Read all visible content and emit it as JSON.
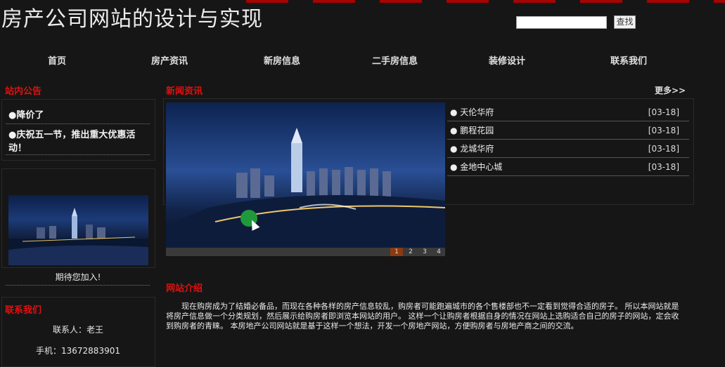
{
  "header": {
    "title": "房产公司网站的设计与实现"
  },
  "search": {
    "placeholder": "",
    "button_label": "查找"
  },
  "nav": {
    "items": [
      "首页",
      "房产资讯",
      "新房信息",
      "二手房信息",
      "装修设计",
      "联系我们"
    ]
  },
  "notice": {
    "title": "站内公告",
    "items": [
      "●降价了",
      "●庆祝五一节，推出重大优惠活动！"
    ]
  },
  "welcome": "期待您加入!",
  "contact": {
    "title": "联系我们",
    "person": "联系人：老王",
    "phone": "手机：13672883901"
  },
  "news": {
    "title": "新闻资讯",
    "more": "更多>>",
    "items": [
      {
        "title": "天伦华府",
        "date": "[03-18]"
      },
      {
        "title": "鹏程花园",
        "date": "[03-18]"
      },
      {
        "title": "龙城华府",
        "date": "[03-18]"
      },
      {
        "title": "金地中心城",
        "date": "[03-18]"
      }
    ]
  },
  "banner": {
    "pages": [
      "1",
      "2",
      "3",
      "4"
    ],
    "active_page": "1",
    "active_color": "#8a3a10"
  },
  "intro": {
    "title": "网站介绍",
    "text": "现在购房成为了结婚必备品，而现在各种各样的房产信息较乱，购房者可能跑遍城市的各个售楼部也不一定看到觉得合适的房子。 所以本网站就是将房产信息做一个分类规划，然后展示给购房者即浏览本网站的用户。 这样一个让购房者根据自身的情况在网站上选购适合自己的房子的网站，定会收到购房者的青睐。 本房地产公司网站就是基于这样一个想法，开发一个房地产网站，方便购房者与房地产商之间的交流。"
  },
  "colors": {
    "accent_red": "#e01010",
    "background": "#161616"
  }
}
